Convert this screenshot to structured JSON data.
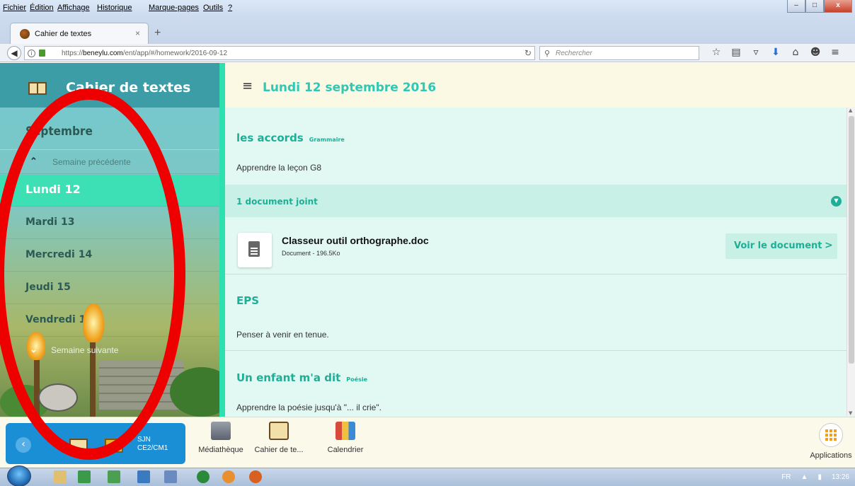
{
  "browser": {
    "menu": [
      "Fichier",
      "Édition",
      "Affichage",
      "Historique",
      "Marque-pages",
      "Outils",
      "?"
    ],
    "window_controls": {
      "minimize": "–",
      "maximize": "□",
      "close": "x"
    },
    "tab": {
      "title": "Cahier de textes",
      "close": "×"
    },
    "newtab": "+",
    "url_prefix": "https://",
    "url_domain": "beneylu.com",
    "url_path": "/ent/app/#/homework/2016-09-12",
    "search_placeholder": "Rechercher",
    "toolbar_icons": [
      "star-icon",
      "reading-list-icon",
      "pocket-icon",
      "download-icon",
      "home-icon",
      "chat-icon",
      "menu-icon"
    ]
  },
  "sidebar": {
    "title": "Cahier de textes",
    "month": "Septembre",
    "prev_week": "Semaine précédente",
    "next_week": "Semaine suivante",
    "days": [
      {
        "label": "Lundi 12",
        "active": true
      },
      {
        "label": "Mardi 13",
        "active": false
      },
      {
        "label": "Mercredi 14",
        "active": false
      },
      {
        "label": "Jeudi 15",
        "active": false
      },
      {
        "label": "Vendredi 16",
        "active": false
      }
    ]
  },
  "content": {
    "date_title": "Lundi 12 septembre 2016",
    "sections": [
      {
        "title": "les accords",
        "tag": "Grammaire",
        "text": "Apprendre la leçon G8"
      },
      {
        "title": "EPS",
        "tag": "",
        "text": "Penser à venir en tenue."
      },
      {
        "title": "Un enfant m'a dit",
        "tag": "Poésie",
        "text": "Apprendre la poésie jusqu'à \"... il crie\"."
      }
    ],
    "attachments_label": "1 document joint",
    "document": {
      "name": "Classeur outil orthographe.doc",
      "meta": "Document - 196.5Ko",
      "view_label": "Voir le document",
      "arrow": ">"
    }
  },
  "ent_bar": {
    "school_name": "SJN",
    "school_class": "CE2/CM1",
    "apps": [
      "Médiathèque",
      "Cahier de te...",
      "Calendrier"
    ],
    "applications_label": "Applications"
  },
  "taskbar": {
    "lang": "FR",
    "time": "13:26"
  },
  "colors": {
    "accent": "#2de0b0",
    "accent_text": "#1fae96",
    "annotation": "#ee0000"
  }
}
